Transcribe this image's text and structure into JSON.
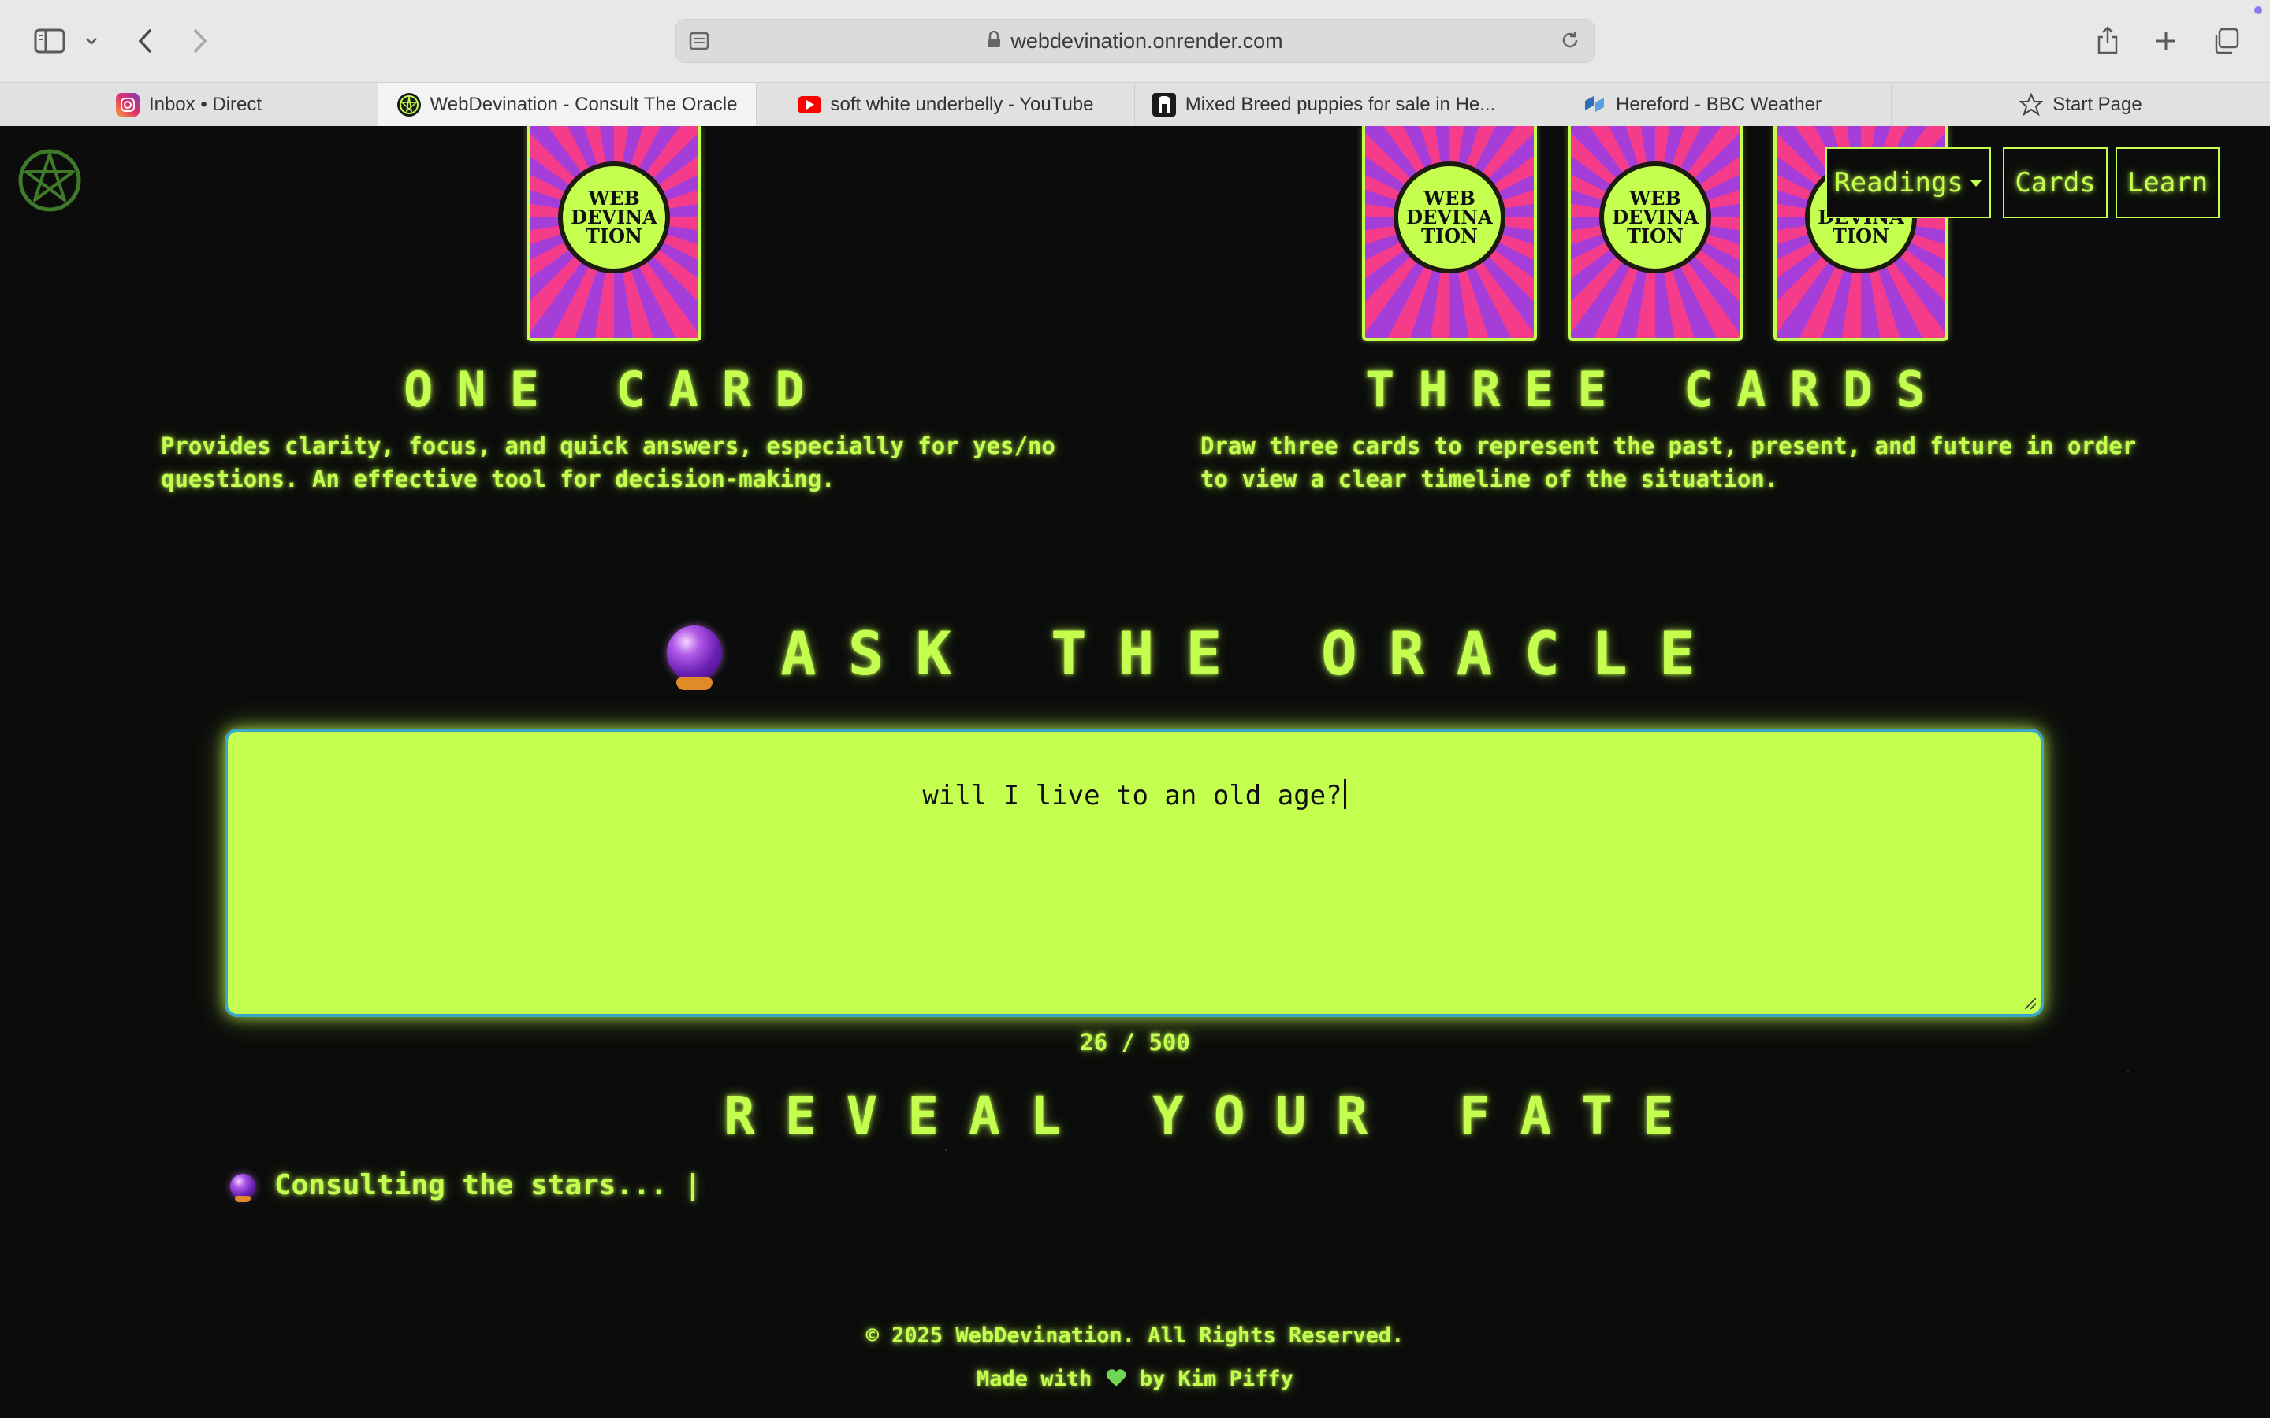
{
  "browser": {
    "url": "webdevination.onrender.com",
    "tabs": [
      {
        "label": "Inbox • Direct",
        "icon": "instagram-icon",
        "active": false
      },
      {
        "label": "WebDevination - Consult The Oracle",
        "icon": "pentagram-icon",
        "active": true
      },
      {
        "label": "soft white underbelly - YouTube",
        "icon": "youtube-icon",
        "active": false
      },
      {
        "label": "Mixed Breed puppies for sale in He...",
        "icon": "dog-icon",
        "active": false
      },
      {
        "label": "Hereford - BBC Weather",
        "icon": "weather-icon",
        "active": false
      },
      {
        "label": "Start Page",
        "icon": "star-icon",
        "active": false
      }
    ]
  },
  "nav": {
    "readings": "Readings",
    "cards": "Cards",
    "learn": "Learn"
  },
  "card_art_text": "WEB\nDEVINA\nTION",
  "spreads": {
    "one": {
      "title": "ONE CARD",
      "desc_line1": "Provides clarity, focus, and quick answers, especially for yes/no",
      "desc_line2": "questions. An effective tool for decision-making."
    },
    "three": {
      "title": "THREE CARDS",
      "desc_line1": "Draw three cards to represent the past, present, and future in order",
      "desc_line2": "to view a clear timeline of the situation."
    }
  },
  "oracle": {
    "title": "ASK THE ORACLE",
    "question": "will I live to an old age?",
    "char_count": "26 / 500",
    "reveal_title": "REVEAL YOUR FATE",
    "status": "Consulting the stars... |"
  },
  "footer": {
    "copyright": "© 2025 WebDevination. All Rights Reserved.",
    "made_with_prefix": "Made with",
    "made_with_suffix": "by Kim Piffy"
  },
  "colors": {
    "neon": "#c4ff50",
    "background": "#0b0c0b",
    "card_pink": "#f53c8a",
    "card_purple": "#a53ed8",
    "input_border": "#3aa7c9"
  }
}
